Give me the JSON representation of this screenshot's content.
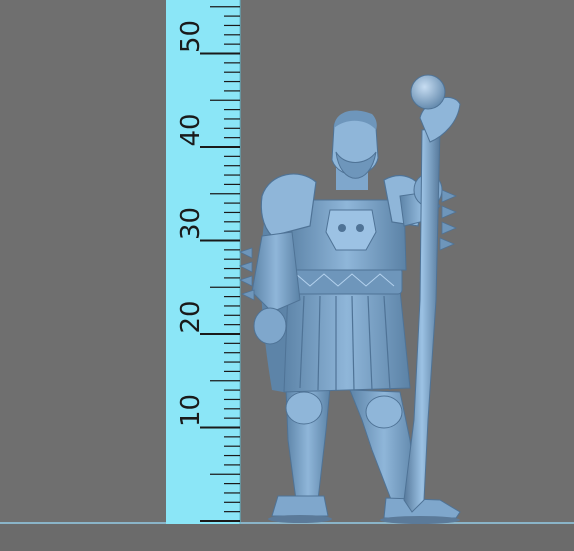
{
  "colors": {
    "background": "#6f6f6f",
    "ruler": "#8be6f7",
    "ruler_ticks": "#1a1a1a",
    "model": "#7fa7cc",
    "model_shadow": "#4f7396",
    "model_highlight": "#b4d2ee"
  },
  "ruler": {
    "unit_labels": [
      "10",
      "20",
      "30",
      "40",
      "50"
    ],
    "values": [
      10,
      20,
      30,
      40,
      50
    ],
    "minor_step": 1,
    "major_step": 5
  },
  "subject": {
    "icon": "warrior-miniature-with-staff"
  }
}
